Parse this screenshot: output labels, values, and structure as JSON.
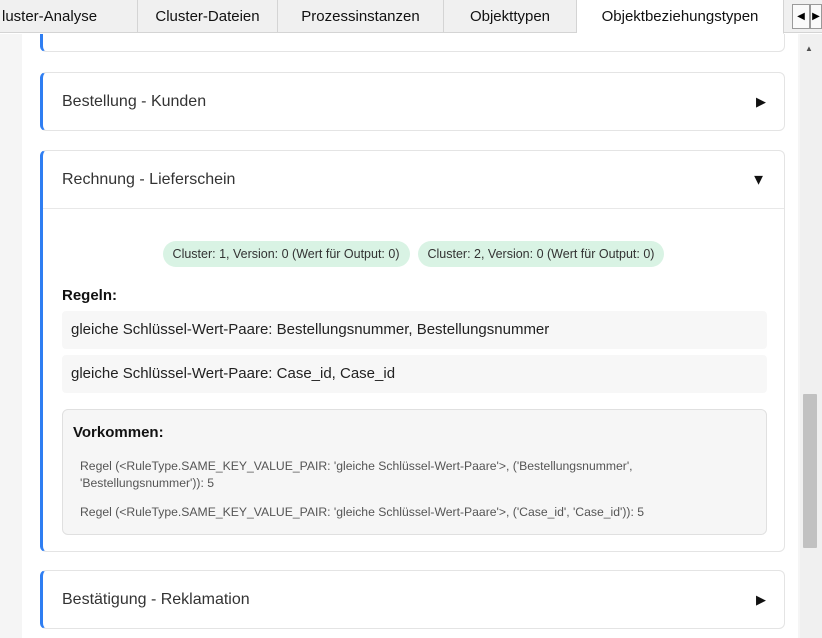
{
  "tabs": [
    {
      "label": "luster-Analyse"
    },
    {
      "label": "Cluster-Dateien"
    },
    {
      "label": "Prozessinstanzen"
    },
    {
      "label": "Objekttypen"
    },
    {
      "label": "Objektbeziehungstypen"
    }
  ],
  "active_tab_index": 4,
  "tab_scroll": {
    "left_glyph": "◀",
    "right_glyph": "▶"
  },
  "cards": [
    {
      "title": "Bestellung - Kunden",
      "expanded": false,
      "chevron": "▶"
    },
    {
      "title": "Rechnung - Lieferschein",
      "expanded": true,
      "chevron": "▼",
      "badges": [
        "Cluster: 1, Version: 0 (Wert für Output: 0)",
        "Cluster: 2, Version: 0 (Wert für Output: 0)"
      ],
      "rules_heading": "Regeln:",
      "rules": [
        "gleiche Schlüssel-Wert-Paare: Bestellungsnummer, Bestellungsnummer",
        "gleiche Schlüssel-Wert-Paare: Case_id, Case_id"
      ],
      "occurrences_heading": "Vorkommen:",
      "occurrences": [
        "Regel (<RuleType.SAME_KEY_VALUE_PAIR: 'gleiche Schlüssel-Wert-Paare'>, ('Bestellungsnummer', 'Bestellungsnummer')): 5",
        "Regel (<RuleType.SAME_KEY_VALUE_PAIR: 'gleiche Schlüssel-Wert-Paare'>, ('Case_id', 'Case_id')): 5"
      ]
    },
    {
      "title": "Bestätigung - Reklamation",
      "expanded": false,
      "chevron": "▶"
    }
  ],
  "scrollbar": {
    "up_glyph": "▲"
  },
  "colors": {
    "accent": "#2f7ef2",
    "badge_bg": "#d9f3e4",
    "tab_bg": "#f0f0f0"
  }
}
